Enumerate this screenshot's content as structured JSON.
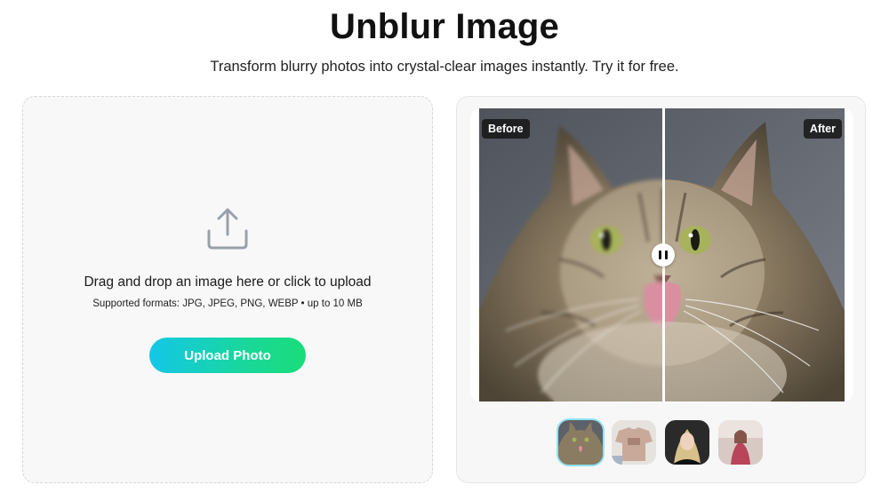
{
  "header": {
    "title": "Unblur Image",
    "subtitle": "Transform blurry photos into crystal-clear images instantly. Try it for free."
  },
  "upload": {
    "instruction": "Drag and drop an image here or click to upload",
    "formats": "Supported formats: JPG, JPEG, PNG, WEBP • up to 10 MB",
    "button_label": "Upload Photo",
    "icon": "upload-icon"
  },
  "compare": {
    "before_label": "Before",
    "after_label": "After",
    "handle_icon": "pause-icon",
    "slider_position": 0.5
  },
  "thumbnails": [
    {
      "subject": "cat",
      "selected": true
    },
    {
      "subject": "clothing",
      "selected": false
    },
    {
      "subject": "portrait",
      "selected": false
    },
    {
      "subject": "person-outdoor",
      "selected": false
    }
  ],
  "colors": {
    "button_gradient_start": "#13c7e8",
    "button_gradient_end": "#1bdc7a",
    "thumb_selected_ring": "#8fe3f0"
  }
}
